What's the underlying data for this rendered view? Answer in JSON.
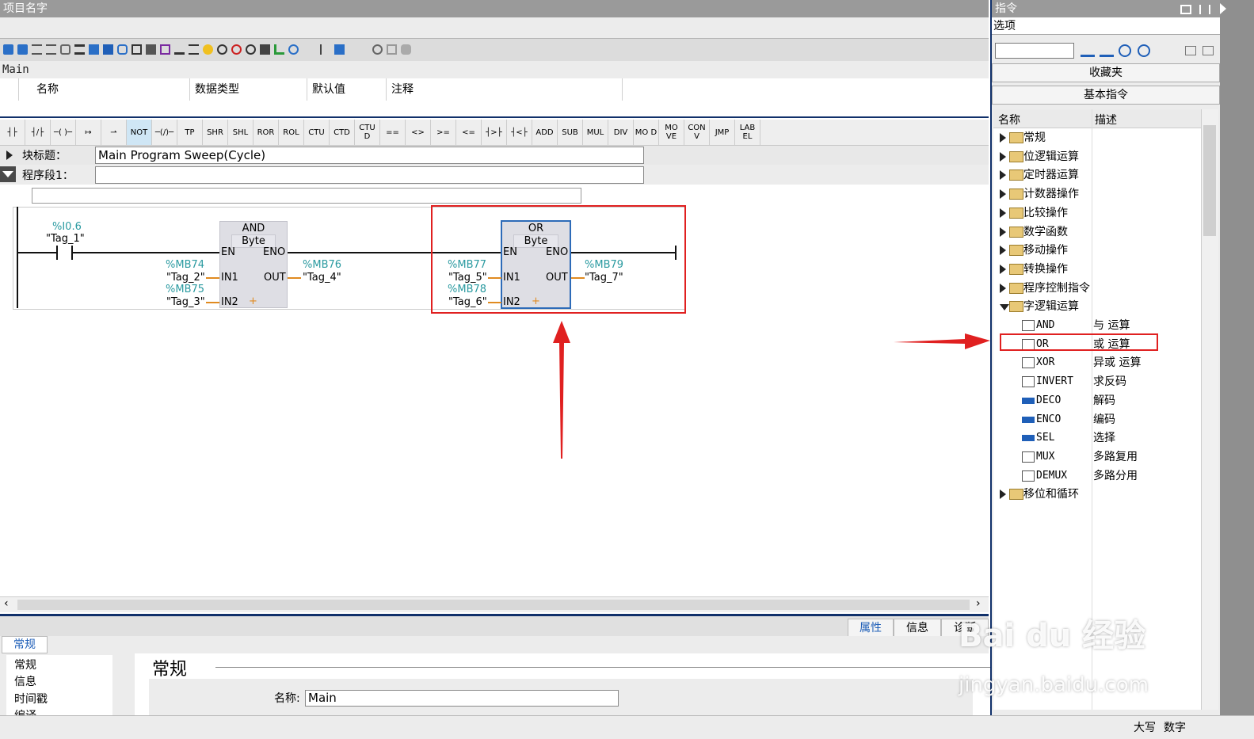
{
  "titlebar": {
    "title": "项目名字"
  },
  "block_name": "Main",
  "interface": {
    "col_name": "名称",
    "col_type": "数据类型",
    "col_default": "默认值",
    "col_comment": "注释"
  },
  "ladder_toolbar": [
    "┤├",
    "┤/├",
    "─( )─",
    "↦",
    "⇀",
    "NOT",
    "─(/)─",
    "TP",
    "SHR",
    "SHL",
    "ROR",
    "ROL",
    "CTU",
    "CTD",
    "CTU D",
    "==",
    "<>",
    ">=",
    "<=",
    "┤>├",
    "┤<├",
    "ADD",
    "SUB",
    "MUL",
    "DIV",
    "MO D",
    "MO VE",
    "CON V",
    "JMP",
    "LAB EL"
  ],
  "block_title": {
    "label": "块标题：",
    "value": "Main Program Sweep(Cycle)"
  },
  "segment": {
    "label": "程序段1："
  },
  "network": {
    "contact": {
      "address": "%I0.6",
      "tag": "\"Tag_1\""
    },
    "and_box": {
      "title": "AND",
      "type": "Byte",
      "en": "EN",
      "eno": "ENO",
      "in1": "IN1",
      "in2": "IN2",
      "out": "OUT",
      "plus": "+",
      "in1_addr": "%MB74",
      "in1_tag": "\"Tag_2\"",
      "in2_addr": "%MB75",
      "in2_tag": "\"Tag_3\"",
      "out_addr": "%MB76",
      "out_tag": "\"Tag_4\""
    },
    "or_box": {
      "title": "OR",
      "type": "Byte",
      "en": "EN",
      "eno": "ENO",
      "in1": "IN1",
      "in2": "IN2",
      "out": "OUT",
      "plus": "+",
      "in1_addr": "%MB77",
      "in1_tag": "\"Tag_5\"",
      "in2_addr": "%MB78",
      "in2_tag": "\"Tag_6\"",
      "out_addr": "%MB79",
      "out_tag": "\"Tag_7\""
    }
  },
  "props_tabs": {
    "properties": "属性",
    "info": "信息",
    "diagnostics": "诊断"
  },
  "props": {
    "tab_general": "常规",
    "nav": [
      "常规",
      "信息",
      "时间戳",
      "编译"
    ],
    "section_title": "常规",
    "name_label": "名称:",
    "name_value": "Main"
  },
  "right_panel": {
    "title": "指令",
    "options": "选项",
    "favorites": "收藏夹",
    "basic": "基本指令",
    "col_name": "名称",
    "col_desc": "描述",
    "folders": [
      "常规",
      "位逻辑运算",
      "定时器运算",
      "计数器操作",
      "比较操作",
      "数学函数",
      "移动操作",
      "转换操作",
      "程序控制指令"
    ],
    "expanded_folder": "字逻辑运算",
    "items": [
      {
        "name": "AND",
        "desc": "与 运算"
      },
      {
        "name": "OR",
        "desc": "或 运算"
      },
      {
        "name": "XOR",
        "desc": "异或 运算"
      },
      {
        "name": "INVERT",
        "desc": "求反码"
      },
      {
        "name": "DECO",
        "desc": "解码"
      },
      {
        "name": "ENCO",
        "desc": "编码"
      },
      {
        "name": "SEL",
        "desc": "选择"
      },
      {
        "name": "MUX",
        "desc": "多路复用"
      },
      {
        "name": "DEMUX",
        "desc": "多路分用"
      }
    ],
    "last_folder": "移位和循环"
  },
  "status": {
    "caps": "大写",
    "num": "数字"
  },
  "watermark": {
    "brand": "Bai du 经验",
    "url": "jingyan.baidu.com"
  },
  "colors": {
    "accent": "#10306a",
    "highlight_red": "#e02020",
    "tag_teal": "#2a9aa0"
  }
}
